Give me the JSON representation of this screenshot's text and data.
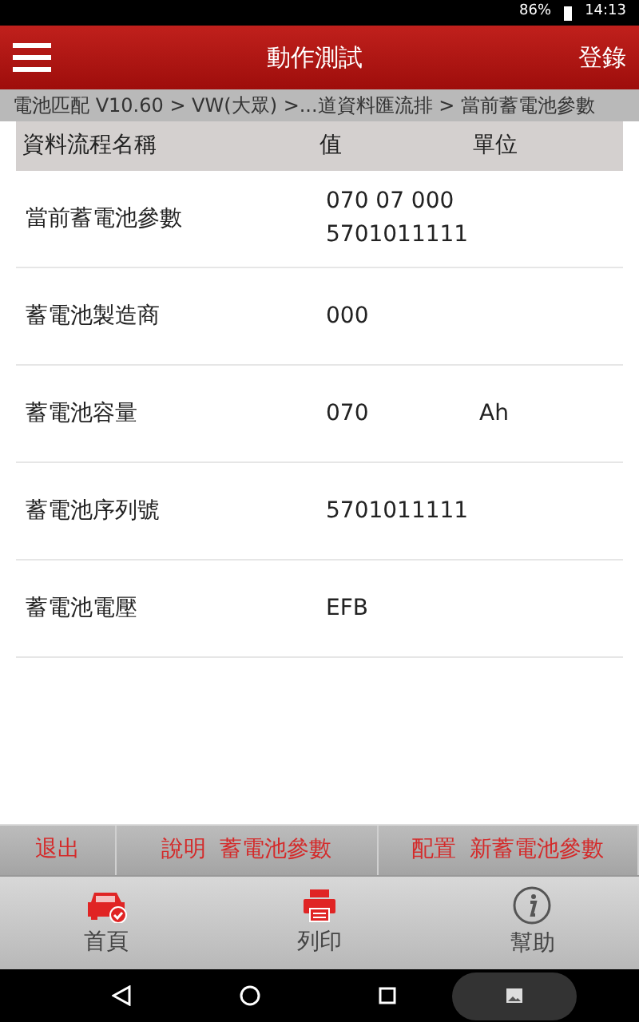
{
  "status_bar": {
    "battery": "86%",
    "time": "14:13"
  },
  "header": {
    "title": "動作測試",
    "action": "登錄"
  },
  "breadcrumb": "電池匹配 V10.60 > VW(大眾) >...道資料匯流排 > 當前蓄電池參數",
  "table": {
    "columns": [
      "資料流程名稱",
      "值",
      "單位"
    ],
    "rows": [
      {
        "name": "當前蓄電池參數",
        "value": [
          "070 07 000",
          "5701011111"
        ],
        "unit": ""
      },
      {
        "name": "蓄電池製造商",
        "value": [
          "000"
        ],
        "unit": ""
      },
      {
        "name": "蓄電池容量",
        "value": [
          "070"
        ],
        "unit": "Ah"
      },
      {
        "name": "蓄電池序列號",
        "value": [
          "5701011111"
        ],
        "unit": ""
      },
      {
        "name": "蓄電池電壓",
        "value": [
          "EFB"
        ],
        "unit": ""
      }
    ]
  },
  "actions": [
    "退出",
    "說明  蓄電池參數",
    "配置  新蓄電池參數"
  ],
  "nav": [
    {
      "kind": "home",
      "label": "首頁"
    },
    {
      "kind": "print",
      "label": "列印"
    },
    {
      "kind": "help",
      "label": "幫助"
    }
  ]
}
